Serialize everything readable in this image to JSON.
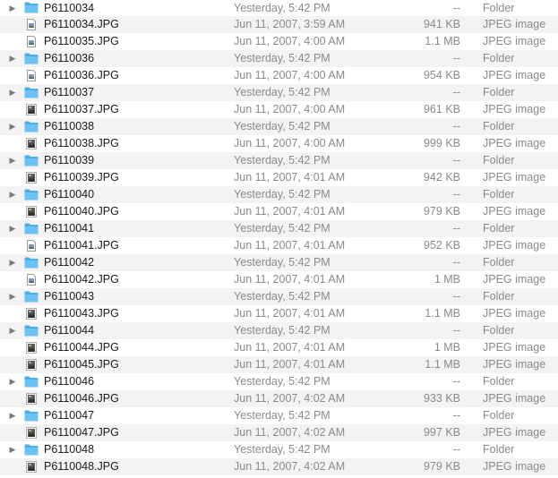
{
  "rows": [
    {
      "type": "folder",
      "name": "P6110034",
      "date": "Yesterday, 5:42 PM",
      "size": "--",
      "kind": "Folder"
    },
    {
      "type": "file",
      "thumb": "doc",
      "name": "P6110034.JPG",
      "date": "Jun 11, 2007, 3:59 AM",
      "size": "941 KB",
      "kind": "JPEG image"
    },
    {
      "type": "file",
      "thumb": "doc",
      "name": "P6110035.JPG",
      "date": "Jun 11, 2007, 4:00 AM",
      "size": "1.1 MB",
      "kind": "JPEG image"
    },
    {
      "type": "folder",
      "name": "P6110036",
      "date": "Yesterday, 5:42 PM",
      "size": "--",
      "kind": "Folder"
    },
    {
      "type": "file",
      "thumb": "doc",
      "name": "P6110036.JPG",
      "date": "Jun 11, 2007, 4:00 AM",
      "size": "954 KB",
      "kind": "JPEG image"
    },
    {
      "type": "folder",
      "name": "P6110037",
      "date": "Yesterday, 5:42 PM",
      "size": "--",
      "kind": "Folder"
    },
    {
      "type": "file",
      "thumb": "photo",
      "name": "P6110037.JPG",
      "date": "Jun 11, 2007, 4:00 AM",
      "size": "961 KB",
      "kind": "JPEG image"
    },
    {
      "type": "folder",
      "name": "P6110038",
      "date": "Yesterday, 5:42 PM",
      "size": "--",
      "kind": "Folder"
    },
    {
      "type": "file",
      "thumb": "photo",
      "name": "P6110038.JPG",
      "date": "Jun 11, 2007, 4:00 AM",
      "size": "999 KB",
      "kind": "JPEG image"
    },
    {
      "type": "folder",
      "name": "P6110039",
      "date": "Yesterday, 5:42 PM",
      "size": "--",
      "kind": "Folder"
    },
    {
      "type": "file",
      "thumb": "photo",
      "name": "P6110039.JPG",
      "date": "Jun 11, 2007, 4:01 AM",
      "size": "942 KB",
      "kind": "JPEG image"
    },
    {
      "type": "folder",
      "name": "P6110040",
      "date": "Yesterday, 5:42 PM",
      "size": "--",
      "kind": "Folder"
    },
    {
      "type": "file",
      "thumb": "photo",
      "name": "P6110040.JPG",
      "date": "Jun 11, 2007, 4:01 AM",
      "size": "979 KB",
      "kind": "JPEG image"
    },
    {
      "type": "folder",
      "name": "P6110041",
      "date": "Yesterday, 5:42 PM",
      "size": "--",
      "kind": "Folder"
    },
    {
      "type": "file",
      "thumb": "doc",
      "name": "P6110041.JPG",
      "date": "Jun 11, 2007, 4:01 AM",
      "size": "952 KB",
      "kind": "JPEG image"
    },
    {
      "type": "folder",
      "name": "P6110042",
      "date": "Yesterday, 5:42 PM",
      "size": "--",
      "kind": "Folder"
    },
    {
      "type": "file",
      "thumb": "doc",
      "name": "P6110042.JPG",
      "date": "Jun 11, 2007, 4:01 AM",
      "size": "1 MB",
      "kind": "JPEG image"
    },
    {
      "type": "folder",
      "name": "P6110043",
      "date": "Yesterday, 5:42 PM",
      "size": "--",
      "kind": "Folder"
    },
    {
      "type": "file",
      "thumb": "photo",
      "name": "P6110043.JPG",
      "date": "Jun 11, 2007, 4:01 AM",
      "size": "1.1 MB",
      "kind": "JPEG image"
    },
    {
      "type": "folder",
      "name": "P6110044",
      "date": "Yesterday, 5:42 PM",
      "size": "--",
      "kind": "Folder"
    },
    {
      "type": "file",
      "thumb": "photo",
      "name": "P6110044.JPG",
      "date": "Jun 11, 2007, 4:01 AM",
      "size": "1 MB",
      "kind": "JPEG image"
    },
    {
      "type": "file",
      "thumb": "photo",
      "name": "P6110045.JPG",
      "date": "Jun 11, 2007, 4:01 AM",
      "size": "1.1 MB",
      "kind": "JPEG image"
    },
    {
      "type": "folder",
      "name": "P6110046",
      "date": "Yesterday, 5:42 PM",
      "size": "--",
      "kind": "Folder"
    },
    {
      "type": "file",
      "thumb": "photo",
      "name": "P6110046.JPG",
      "date": "Jun 11, 2007, 4:02 AM",
      "size": "933 KB",
      "kind": "JPEG image"
    },
    {
      "type": "folder",
      "name": "P6110047",
      "date": "Yesterday, 5:42 PM",
      "size": "--",
      "kind": "Folder"
    },
    {
      "type": "file",
      "thumb": "photo",
      "name": "P6110047.JPG",
      "date": "Jun 11, 2007, 4:02 AM",
      "size": "997 KB",
      "kind": "JPEG image"
    },
    {
      "type": "folder",
      "name": "P6110048",
      "date": "Yesterday, 5:42 PM",
      "size": "--",
      "kind": "Folder"
    },
    {
      "type": "file",
      "thumb": "photo",
      "name": "P6110048.JPG",
      "date": "Jun 11, 2007, 4:02 AM",
      "size": "979 KB",
      "kind": "JPEG image"
    }
  ],
  "icons": {
    "folder": "folder-icon",
    "doc": "image-document-icon",
    "photo": "photo-thumbnail-icon",
    "disclosure": "disclosure-triangle-icon"
  },
  "colors": {
    "folder_front": "#6cc2f5",
    "folder_back": "#4aaeea",
    "row_alt": "#f3f3f3",
    "secondary_text": "#8a8a8a"
  }
}
